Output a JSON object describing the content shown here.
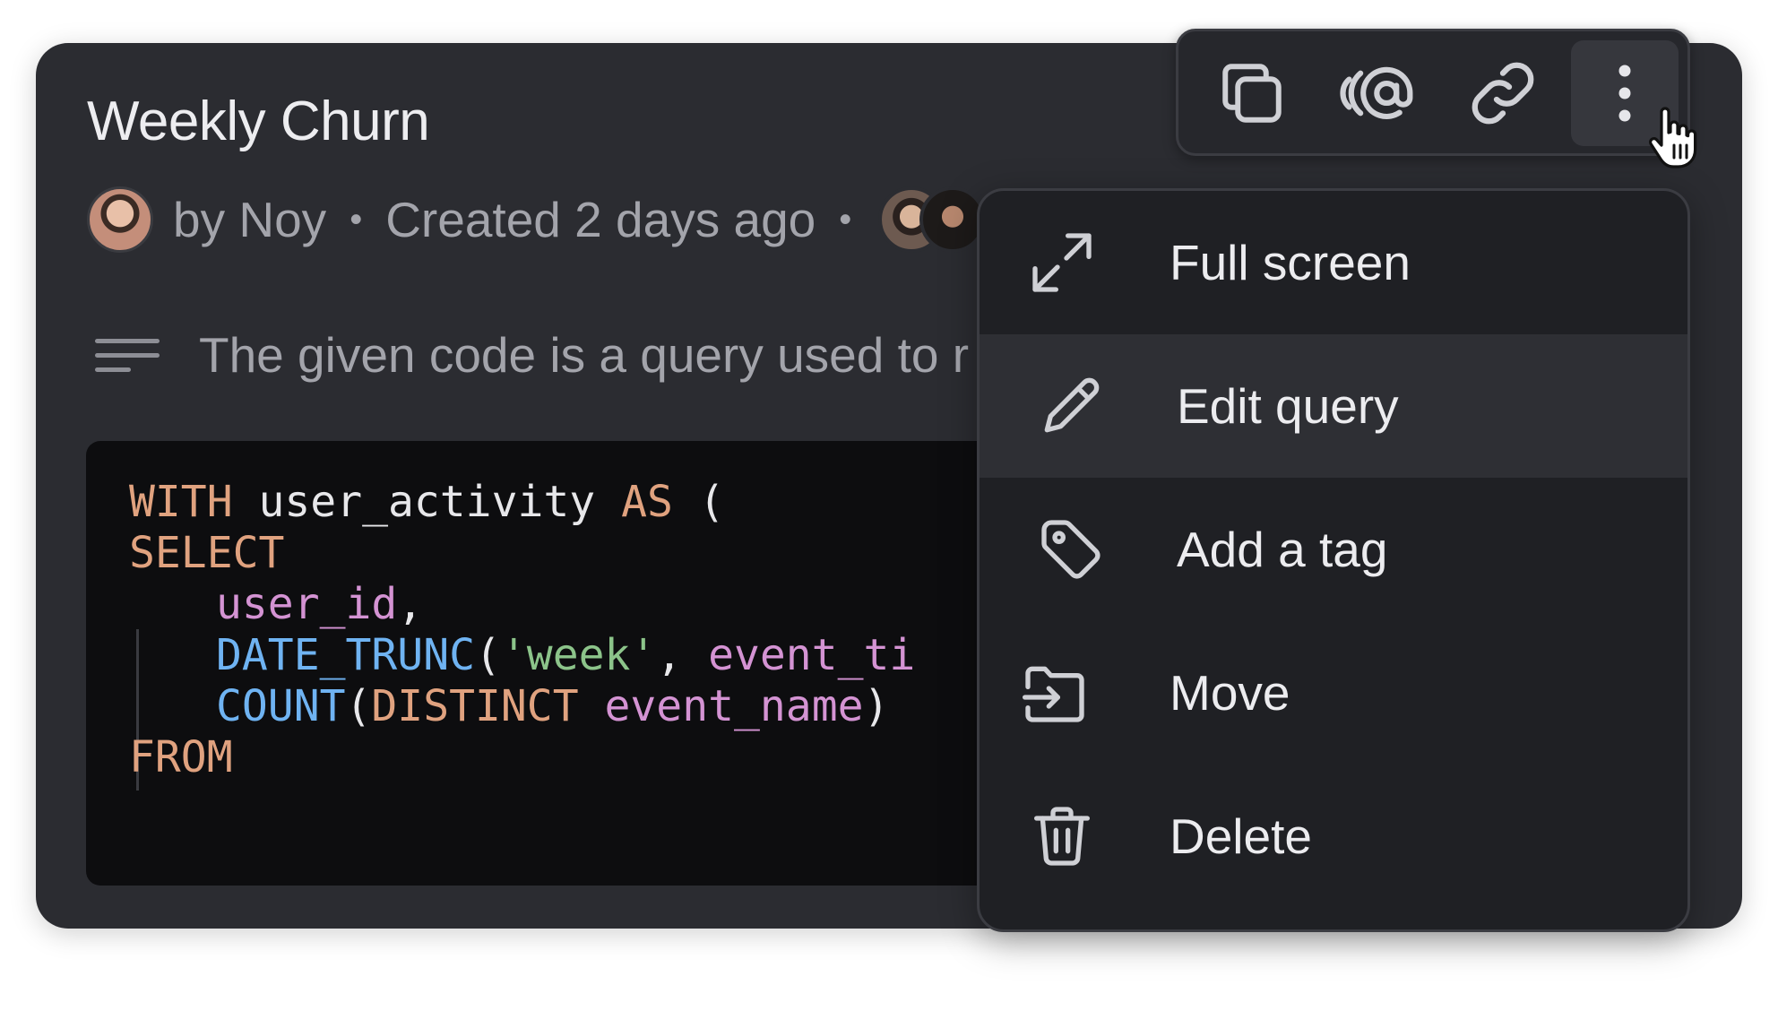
{
  "query": {
    "title": "Weekly Churn",
    "author_text": "by Noy",
    "separator": "•",
    "created_text": "Created 2 days ago",
    "description": "The given code is a query used to r"
  },
  "code": {
    "line1": {
      "kw1": "WITH",
      "name": " user_activity ",
      "kw2": "AS",
      "paren": " ("
    },
    "line2": {
      "kw": "SELECT"
    },
    "line3": {
      "id": "user_id",
      "punct": ","
    },
    "line4": {
      "fn": "DATE_TRUNC",
      "open": "(",
      "str": "'week'",
      "comma": ", ",
      "id": "event_ti"
    },
    "line5": {
      "fn": "COUNT",
      "open": "(",
      "kw": "DISTINCT",
      "space": " ",
      "id": "event_name",
      "close": ")"
    },
    "line6": {
      "kw": "FROM"
    }
  },
  "toolbar": {
    "buttons": [
      {
        "icon": "copy-icon"
      },
      {
        "icon": "mention-icon"
      },
      {
        "icon": "link-icon"
      },
      {
        "icon": "more-vertical-icon",
        "active": true
      }
    ]
  },
  "menu": {
    "items": [
      {
        "label": "Full screen",
        "icon": "expand-icon"
      },
      {
        "label": "Edit query",
        "icon": "pencil-icon",
        "hovered": true
      },
      {
        "label": "Add a tag",
        "icon": "tag-icon"
      },
      {
        "label": "Move",
        "icon": "folder-move-icon"
      },
      {
        "label": "Delete",
        "icon": "trash-icon"
      }
    ]
  },
  "colors": {
    "card_bg": "#2b2c31",
    "menu_bg": "#1f2024",
    "code_bg": "#0d0d0f",
    "keyword": "#e0a27f",
    "function": "#6fb3f2",
    "identifier": "#d493d3",
    "string": "#8cc48a"
  }
}
